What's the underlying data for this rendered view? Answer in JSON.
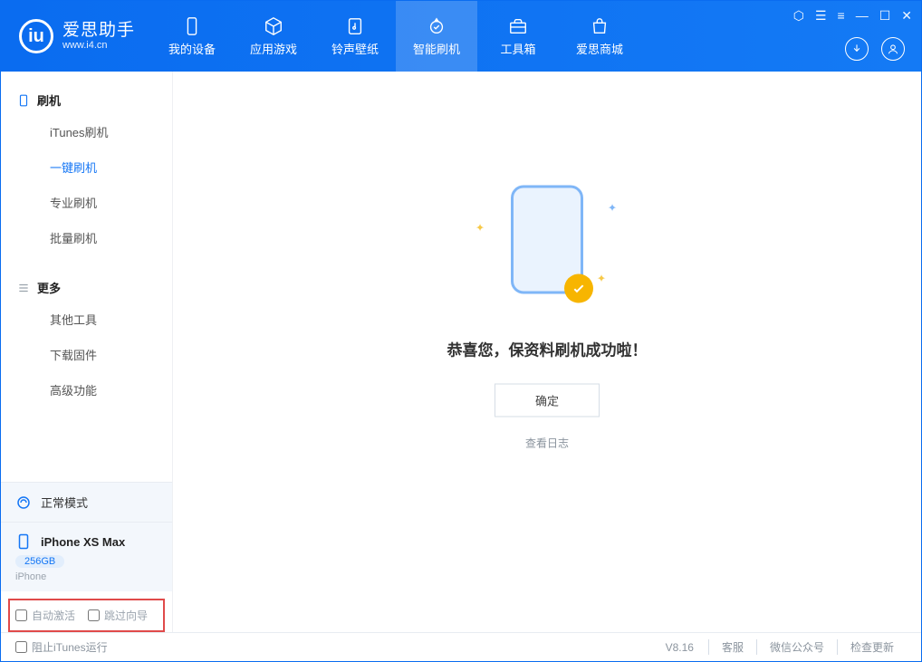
{
  "brand": {
    "name_cn": "爱思助手",
    "url": "www.i4.cn"
  },
  "nav": {
    "items": [
      {
        "label": "我的设备",
        "icon": "device-icon"
      },
      {
        "label": "应用游戏",
        "icon": "cube-icon"
      },
      {
        "label": "铃声壁纸",
        "icon": "music-icon"
      },
      {
        "label": "智能刷机",
        "icon": "refresh-icon",
        "active": true
      },
      {
        "label": "工具箱",
        "icon": "toolbox-icon"
      },
      {
        "label": "爱思商城",
        "icon": "store-icon"
      }
    ]
  },
  "sidebar": {
    "group1": {
      "title": "刷机",
      "items": [
        {
          "label": "iTunes刷机"
        },
        {
          "label": "一键刷机",
          "active": true
        },
        {
          "label": "专业刷机"
        },
        {
          "label": "批量刷机"
        }
      ]
    },
    "group2": {
      "title": "更多",
      "items": [
        {
          "label": "其他工具"
        },
        {
          "label": "下载固件"
        },
        {
          "label": "高级功能"
        }
      ]
    }
  },
  "device": {
    "mode": "正常模式",
    "name": "iPhone XS Max",
    "storage": "256GB",
    "type": "iPhone"
  },
  "options": {
    "auto_activate": "自动激活",
    "skip_guide": "跳过向导"
  },
  "main": {
    "success_text": "恭喜您，保资料刷机成功啦！",
    "ok_button": "确定",
    "view_log": "查看日志"
  },
  "footer": {
    "block_itunes": "阻止iTunes运行",
    "version": "V8.16",
    "links": [
      "客服",
      "微信公众号",
      "检查更新"
    ]
  }
}
